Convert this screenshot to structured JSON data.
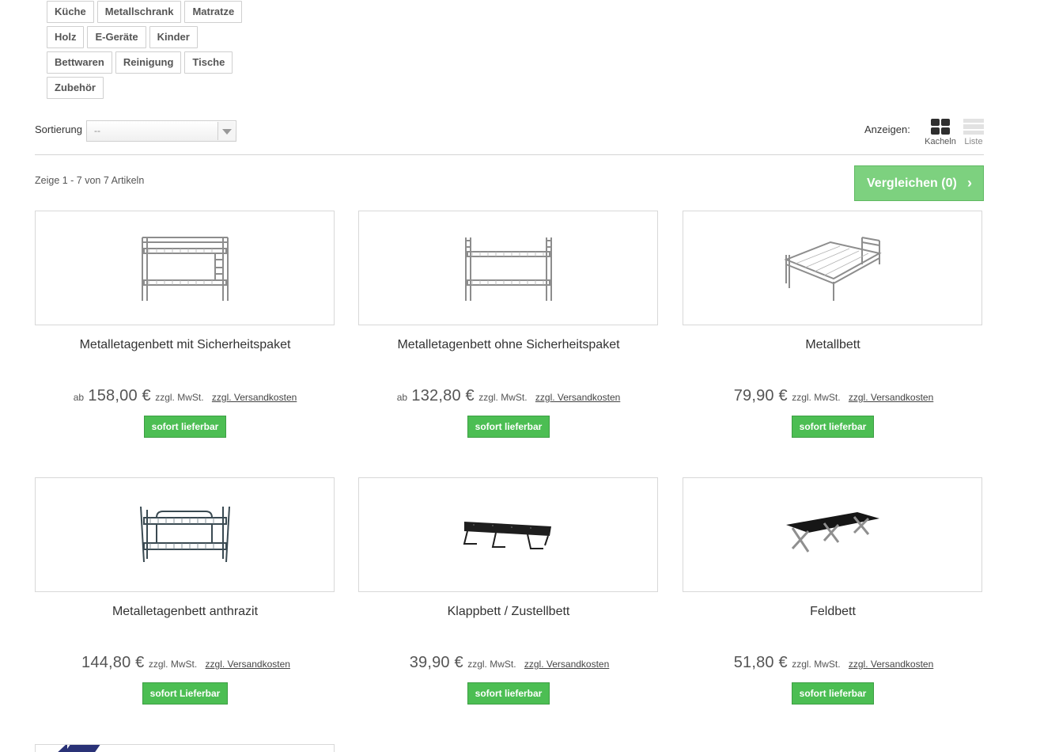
{
  "tags": [
    [
      "Küche",
      "Metallschrank",
      "Matratze"
    ],
    [
      "Holz",
      "E-Geräte",
      "Kinder"
    ],
    [
      "Bettwaren",
      "Reinigung",
      "Tische"
    ],
    [
      "Zubehör"
    ]
  ],
  "sort": {
    "label": "Sortierung",
    "selected": "--"
  },
  "view": {
    "label": "Anzeigen:",
    "tiles_label": "Kacheln",
    "list_label": "Liste",
    "active": "Kacheln"
  },
  "listing": {
    "count_text": "Zeige 1 - 7 von 7 Artikeln",
    "compare_label": "Vergleichen (0)",
    "compare_chevron": "›"
  },
  "colors": {
    "available_green": "#4cbe53",
    "compare_green": "#7dd17f",
    "logo_navy": "#2a3277"
  },
  "products": [
    {
      "name": "Metalletagenbett mit Sicherheitspaket",
      "ab": "ab",
      "price": "158,00 €",
      "tax": "zzgl. MwSt.",
      "shipping": "zzgl. Versandkosten",
      "availability": "sofort lieferbar",
      "image_icon": "bunk-bed-with-ladder"
    },
    {
      "name": "Metalletagenbett ohne Sicherheitspaket",
      "ab": "ab",
      "price": "132,80 €",
      "tax": "zzgl. MwSt.",
      "shipping": "zzgl. Versandkosten",
      "availability": "sofort lieferbar",
      "image_icon": "bunk-bed"
    },
    {
      "name": "Metallbett",
      "ab": "",
      "price": "79,90 €",
      "tax": "zzgl. MwSt.",
      "shipping": "zzgl. Versandkosten",
      "availability": "sofort lieferbar",
      "image_icon": "metal-bed"
    },
    {
      "name": "Metalletagenbett anthrazit",
      "ab": "",
      "price": "144,80 €",
      "tax": "zzgl. MwSt.",
      "shipping": "zzgl. Versandkosten",
      "availability": "sofort Lieferbar",
      "image_icon": "bunk-bed-anthracite"
    },
    {
      "name": "Klappbett / Zustellbett",
      "ab": "",
      "price": "39,90 €",
      "tax": "zzgl. MwSt.",
      "shipping": "zzgl. Versandkosten",
      "availability": "sofort lieferbar",
      "image_icon": "folding-bed"
    },
    {
      "name": "Feldbett",
      "ab": "",
      "price": "51,80 €",
      "tax": "zzgl. MwSt.",
      "shipping": "zzgl. Versandkosten",
      "availability": "sofort lieferbar",
      "image_icon": "camp-bed"
    }
  ]
}
